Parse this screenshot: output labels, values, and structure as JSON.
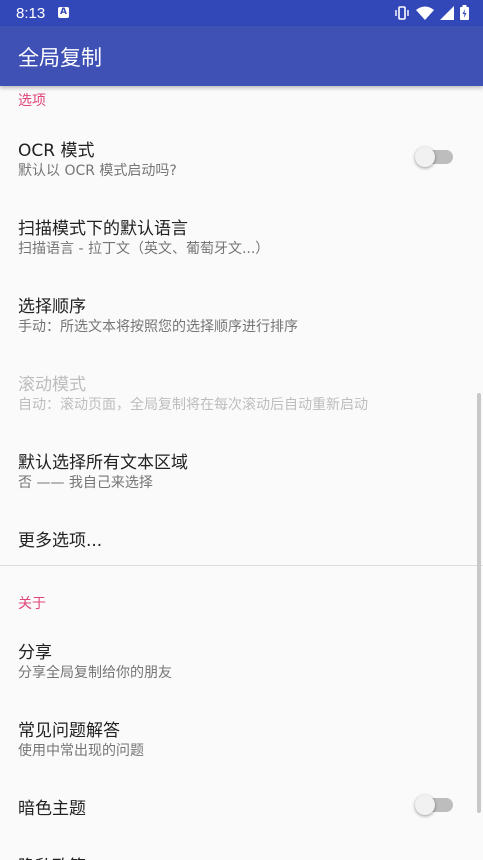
{
  "status_bar": {
    "time": "8:13",
    "notification_icon": "a-notification-icon",
    "icons": [
      "vibrate-icon",
      "wifi-icon",
      "signal-icon",
      "battery-icon"
    ]
  },
  "app_bar": {
    "title": "全局复制"
  },
  "sections": {
    "options_header": "选项",
    "about_header": "关于"
  },
  "items": {
    "ocr": {
      "title": "OCR 模式",
      "summary": "默认以 OCR 模式启动吗?"
    },
    "scan_lang": {
      "title": "扫描模式下的默认语言",
      "summary": "扫描语言 - 拉丁文（英文、葡萄牙文...）"
    },
    "order": {
      "title": "选择顺序",
      "summary": "手动：所选文本将按照您的选择顺序进行排序"
    },
    "scroll": {
      "title": "滚动模式",
      "summary": "自动：滚动页面，全局复制将在每次滚动后自动重新启动"
    },
    "select_all": {
      "title": "默认选择所有文本区域",
      "summary": "否 —— 我自己来选择"
    },
    "more": {
      "title": "更多选项..."
    },
    "share": {
      "title": "分享",
      "summary": "分享全局复制给你的朋友"
    },
    "faq": {
      "title": "常见问题解答",
      "summary": "使用中常出现的问题"
    },
    "dark": {
      "title": "暗色主题"
    },
    "privacy": {
      "title": "隐私政策"
    }
  },
  "colors": {
    "primary": "#3f51b5",
    "primary_dark": "#3348b8",
    "accent": "#e0457b"
  }
}
